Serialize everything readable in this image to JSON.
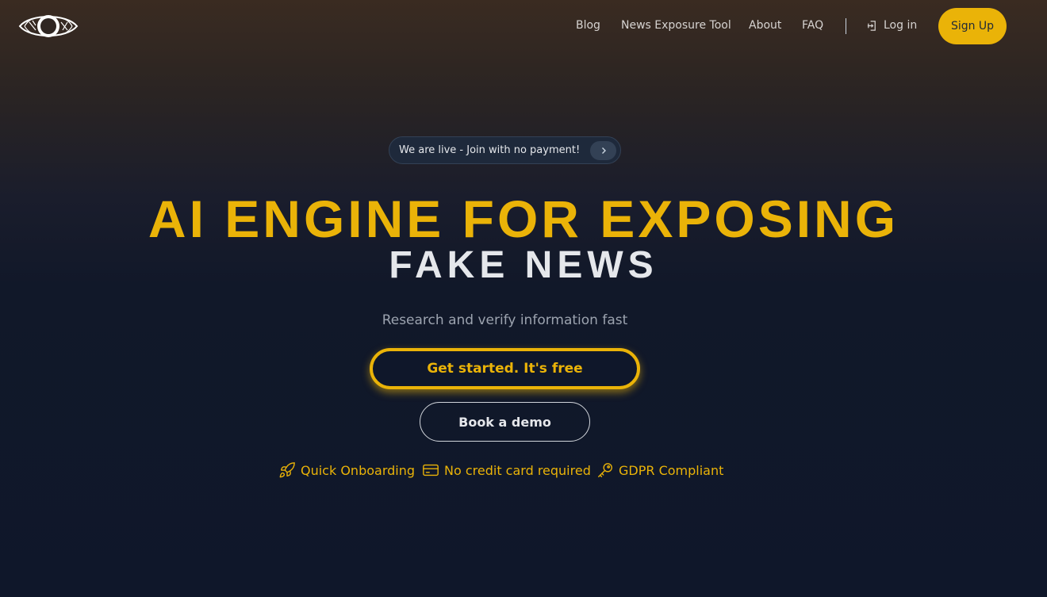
{
  "nav": {
    "links": [
      "Blog",
      "News Exposure Tool",
      "About",
      "FAQ"
    ],
    "login_label": "Log in",
    "signup_label": "Sign Up"
  },
  "announcement": {
    "text": "We are live - Join with no payment!"
  },
  "hero": {
    "headline_line1": "AI ENGINE FOR EXPOSING",
    "headline_line2": "FAKE NEWS",
    "subtitle": "Research and verify information fast",
    "primary_cta": "Get started. It's free",
    "secondary_cta": "Book a demo"
  },
  "features": [
    {
      "icon": "rocket-icon",
      "label": "Quick Onboarding"
    },
    {
      "icon": "credit-card-icon",
      "label": "No credit card required"
    },
    {
      "icon": "key-icon",
      "label": "GDPR Compliant"
    }
  ],
  "colors": {
    "accent": "#eab308",
    "background": "#0f172a",
    "text_light": "#e5e7eb",
    "text_muted": "#9ca3af"
  }
}
